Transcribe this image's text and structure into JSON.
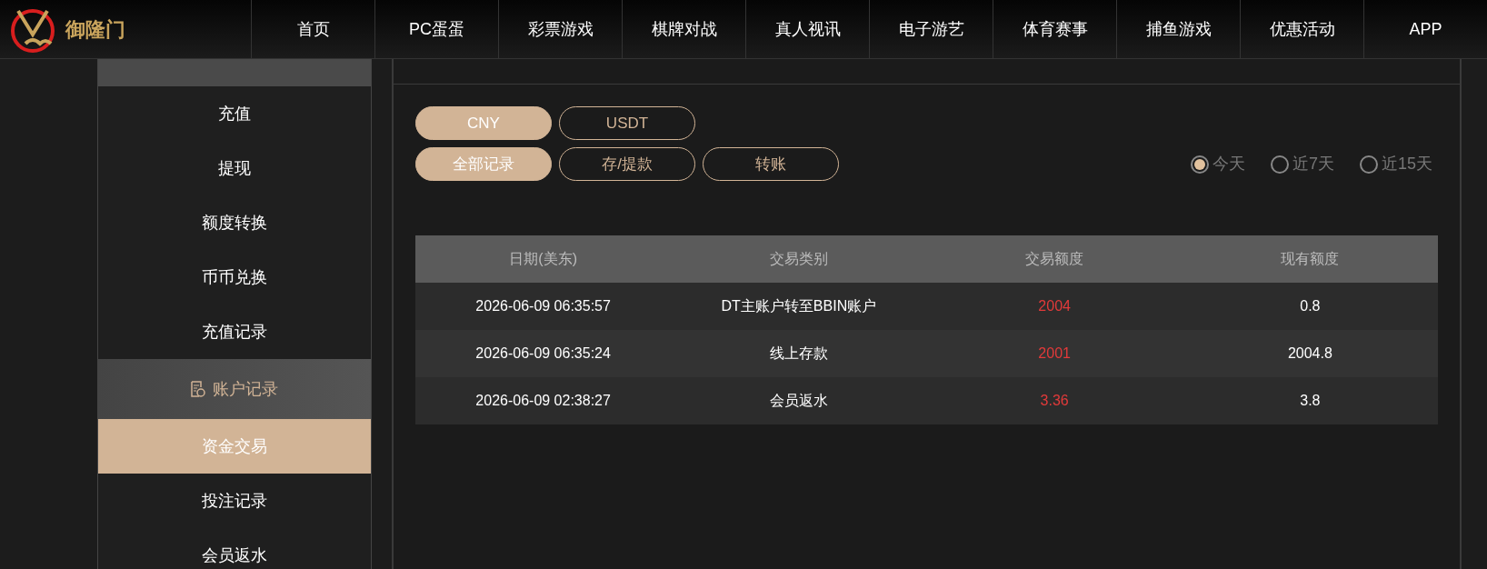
{
  "brand": {
    "name": "御隆门"
  },
  "nav": [
    {
      "label": "首页"
    },
    {
      "label": "PC蛋蛋"
    },
    {
      "label": "彩票游戏"
    },
    {
      "label": "棋牌对战"
    },
    {
      "label": "真人视讯"
    },
    {
      "label": "电子游艺"
    },
    {
      "label": "体育赛事"
    },
    {
      "label": "捕鱼游戏"
    },
    {
      "label": "优惠活动"
    },
    {
      "label": "APP"
    }
  ],
  "sidebar": {
    "items": [
      {
        "kind": "item",
        "label": "充值",
        "selected": false
      },
      {
        "kind": "item",
        "label": "提现",
        "selected": false
      },
      {
        "kind": "item",
        "label": "额度转换",
        "selected": false
      },
      {
        "kind": "item",
        "label": "币币兑换",
        "selected": false
      },
      {
        "kind": "item",
        "label": "充值记录",
        "selected": false
      },
      {
        "kind": "header",
        "label": "账户记录"
      },
      {
        "kind": "item",
        "label": "资金交易",
        "selected": true
      },
      {
        "kind": "item",
        "label": "投注记录",
        "selected": false
      },
      {
        "kind": "item",
        "label": "会员返水",
        "selected": false
      }
    ]
  },
  "currencies": [
    {
      "label": "CNY",
      "selected": true
    },
    {
      "label": "USDT",
      "selected": false
    }
  ],
  "record_types": [
    {
      "label": "全部记录",
      "selected": true
    },
    {
      "label": "存/提款",
      "selected": false
    },
    {
      "label": "转账",
      "selected": false
    }
  ],
  "periods": [
    {
      "label": "今天",
      "selected": true
    },
    {
      "label": "近7天",
      "selected": false
    },
    {
      "label": "近15天",
      "selected": false
    }
  ],
  "table": {
    "columns": [
      "日期(美东)",
      "交易类别",
      "交易额度",
      "现有额度"
    ],
    "rows": [
      [
        "2026-06-09 06:35:57",
        "DT主账户转至BBIN账户",
        "2004",
        "0.8"
      ],
      [
        "2026-06-09 06:35:24",
        "线上存款",
        "2001",
        "2004.8"
      ],
      [
        "2026-06-09 02:38:27",
        "会员返水",
        "3.36",
        "3.8"
      ]
    ]
  }
}
